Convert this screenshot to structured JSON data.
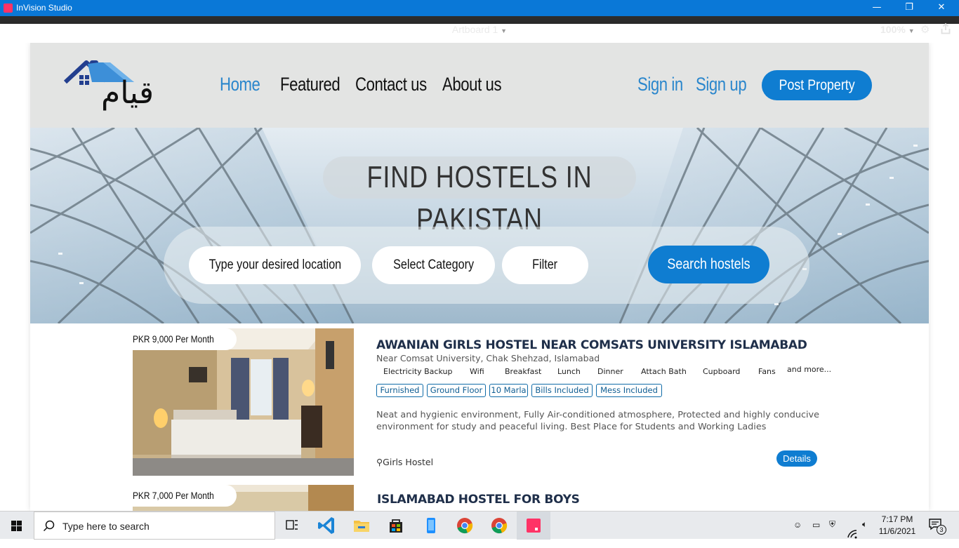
{
  "window": {
    "app_title": "InVision Studio",
    "minimize": "—",
    "restore": "❐",
    "close": "✕"
  },
  "toolbar": {
    "artboard_label": "Artboard 1",
    "zoom": "100%"
  },
  "site": {
    "logo_text": "قيام",
    "nav": {
      "home": "Home",
      "featured": "Featured",
      "contact": "Contact us",
      "about": "About us",
      "signin": "Sign in",
      "signup": "Sign up",
      "post": "Post Property"
    },
    "hero": {
      "title": "FIND HOSTELS IN PAKISTAN",
      "location_placeholder": "Type your desired location",
      "category": "Select Category",
      "filter": "Filter",
      "search_button": "Search hostels"
    },
    "listings": [
      {
        "price": "PKR 9,000 Per Month",
        "title": "AWANIAN GIRLS HOSTEL NEAR COMSATS UNIVERSITY ISLAMABAD",
        "address": "Near Comsat University, Chak Shehzad, Islamabad",
        "amenities": [
          "Electricity Backup",
          "Wifi",
          "Breakfast",
          "Lunch",
          "Dinner",
          "Attach Bath",
          "Cupboard",
          "Fans"
        ],
        "more": "and more...",
        "tags": [
          "Furnished",
          "Ground Floor",
          "10 Marla",
          "Bills Included",
          "Mess Included"
        ],
        "description": "Neat and hygienic environment, Fully Air-conditioned atmosphere, Protected and highly conducive environment for study and peaceful living. Best Place for Students and Working Ladies",
        "type": "Girls Hostel",
        "details_label": "Details"
      },
      {
        "price": "PKR 7,000 Per Month",
        "title": "ISLAMABAD HOSTEL FOR BOYS"
      }
    ]
  },
  "taskbar": {
    "search_placeholder": "Type here to search",
    "time": "7:17 PM",
    "date": "11/6/2021",
    "notifications": "3"
  }
}
